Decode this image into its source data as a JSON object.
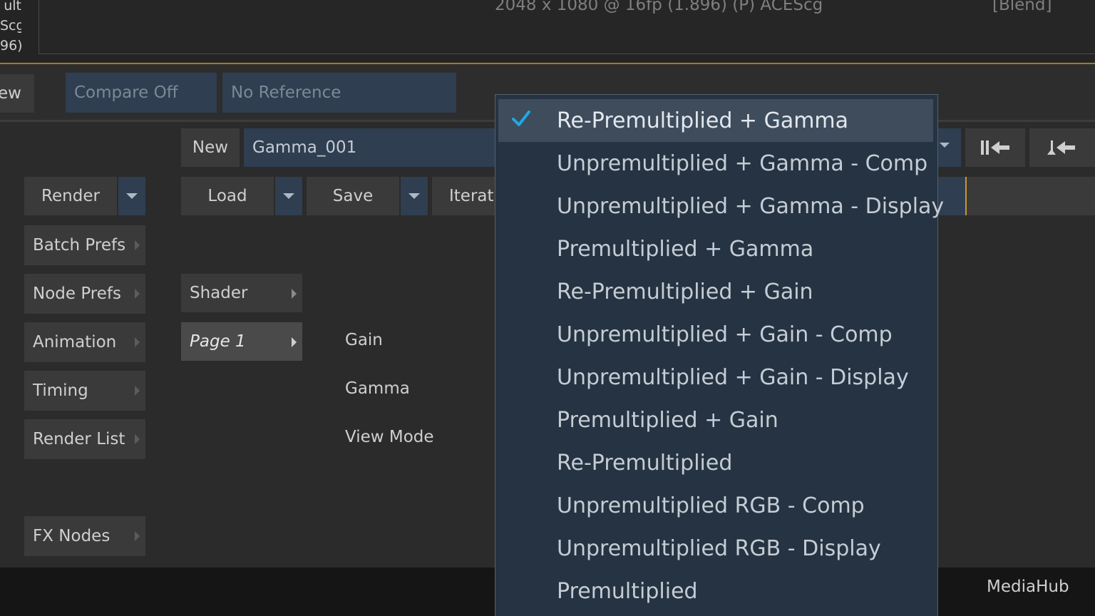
{
  "viewer": {
    "side_text": [
      "ult",
      "Scg",
      "96)"
    ],
    "info": "2048 x 1080 @ 16fp (1.896) (P) ACEScg",
    "blend": "[Blend]"
  },
  "compare_row": {
    "view_fragment": "ew",
    "compare": "Compare Off",
    "reference": "No Reference"
  },
  "toolbar": {
    "new_label": "New",
    "setup_name": "Gamma_001",
    "render_label": "Render",
    "load_label": "Load",
    "save_label": "Save",
    "iterate_label": "Iterat"
  },
  "left_menu": {
    "items": [
      {
        "label": "Batch Prefs"
      },
      {
        "label": "Node Prefs"
      },
      {
        "label": "Animation"
      },
      {
        "label": "Timing"
      },
      {
        "label": "Render List"
      },
      {
        "label": "FX Nodes"
      }
    ]
  },
  "pages": {
    "shader": "Shader",
    "page1": "Page 1"
  },
  "params": {
    "gain": "Gain",
    "gamma": "Gamma",
    "view_mode": "View Mode"
  },
  "status": {
    "mediahub": "MediaHub"
  },
  "colors": {
    "accent_check": "#1fa8e0",
    "dropdown_bg": "#253342",
    "selected_bg": "#3e4c5c",
    "viewer_outline": "#a47a2a"
  },
  "dropdown": {
    "selected_index": 0,
    "items": [
      "Re-Premultiplied + Gamma",
      "Unpremultiplied + Gamma - Comp",
      "Unpremultiplied + Gamma - Display",
      "Premultiplied + Gamma",
      "Re-Premultiplied + Gain",
      "Unpremultiplied + Gain - Comp",
      "Unpremultiplied + Gain - Display",
      "Premultiplied + Gain",
      "Re-Premultiplied",
      "Unpremultiplied RGB - Comp",
      "Unpremultiplied RGB - Display",
      "Premultiplied"
    ]
  }
}
